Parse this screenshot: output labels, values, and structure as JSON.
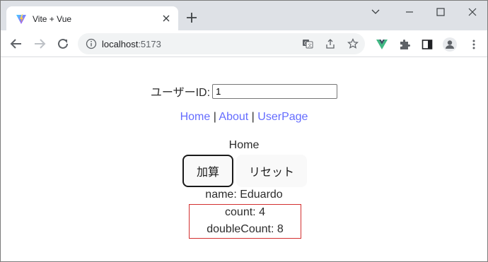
{
  "browser": {
    "tab_title": "Vite + Vue",
    "url_host": "localhost",
    "url_port": ":5173",
    "icons": {
      "favicon": "vite-logo-icon",
      "close": "close-icon",
      "new_tab": "plus-icon",
      "back": "arrow-left-icon",
      "forward": "arrow-right-icon",
      "reload": "reload-icon",
      "info": "info-icon",
      "translate": "translate-icon",
      "share": "share-icon",
      "bookmark": "star-icon",
      "vue_devtools": "vue-icon",
      "extensions": "puzzle-icon",
      "side_panel": "side-panel-icon",
      "profile": "profile-icon",
      "menu": "kebab-menu-icon"
    }
  },
  "app": {
    "userid_label": "ユーザーID:",
    "userid_value": "1",
    "nav": {
      "home": "Home",
      "sep1": " | ",
      "about": "About",
      "sep2": " | ",
      "userpage": "UserPage"
    },
    "heading": "Home",
    "buttons": {
      "add": "加算",
      "reset": "リセット"
    },
    "name_line": "name: Eduardo",
    "count_line": "count: 4",
    "double_count_line": "doubleCount: 8",
    "colors": {
      "link": "#646cff",
      "counter_border": "#d32f2f"
    }
  }
}
